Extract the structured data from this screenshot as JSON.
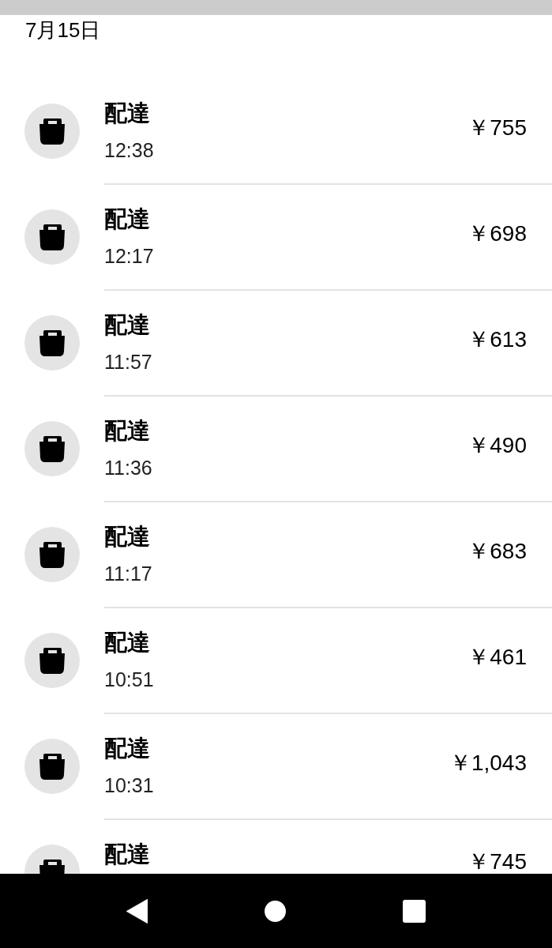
{
  "date_header": "7月15日",
  "transactions": [
    {
      "title": "配達",
      "time": "12:38",
      "amount": "￥755"
    },
    {
      "title": "配達",
      "time": "12:17",
      "amount": "￥698"
    },
    {
      "title": "配達",
      "time": "11:57",
      "amount": "￥613"
    },
    {
      "title": "配達",
      "time": "11:36",
      "amount": "￥490"
    },
    {
      "title": "配達",
      "time": "11:17",
      "amount": "￥683"
    },
    {
      "title": "配達",
      "time": "10:51",
      "amount": "￥461"
    },
    {
      "title": "配達",
      "time": "10:31",
      "amount": "￥1,043"
    },
    {
      "title": "配達",
      "amount": "￥745"
    }
  ]
}
